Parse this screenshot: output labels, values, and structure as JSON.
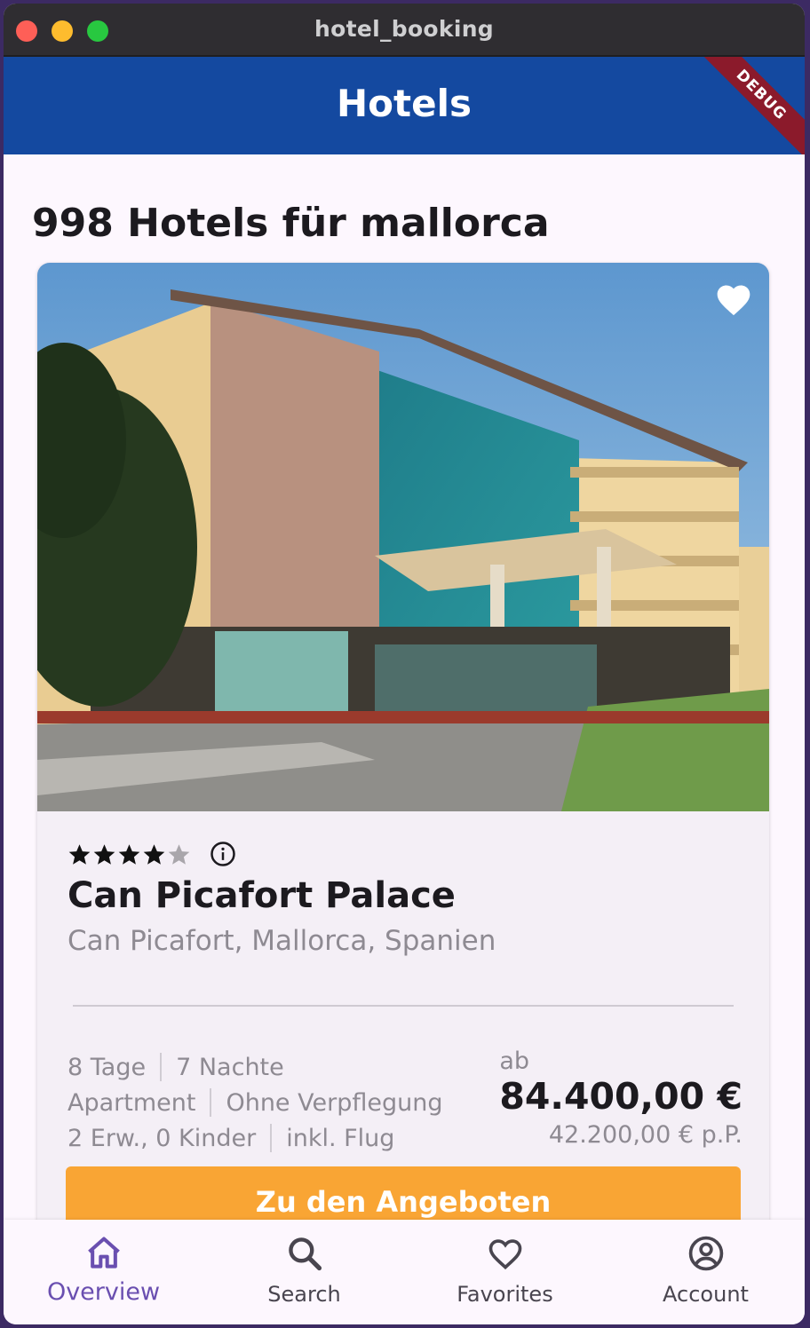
{
  "window": {
    "title": "hotel_booking"
  },
  "appbar": {
    "title": "Hotels",
    "debug_banner": "DEBUG"
  },
  "results": {
    "heading": "998 Hotels für mallorca"
  },
  "hotel": {
    "stars": 4,
    "max_stars": 5,
    "name": "Can Picafort Palace",
    "location": "Can Picafort, Mallorca, Spanien",
    "duration_days": "8 Tage",
    "duration_nights": "7 Nachte",
    "room_type": "Apartment",
    "board": "Ohne Verpflegung",
    "travellers": "2 Erw., 0 Kinder",
    "transport": "inkl. Flug",
    "price_prefix": "ab",
    "price_total": "84.400,00 €",
    "price_per_person": "42.200,00 € p.P.",
    "favorite": true,
    "cta_label": "Zu den Angeboten"
  },
  "nav": {
    "items": [
      {
        "label": "Overview",
        "icon": "home-icon",
        "active": true
      },
      {
        "label": "Search",
        "icon": "search-icon",
        "active": false
      },
      {
        "label": "Favorites",
        "icon": "heart-icon",
        "active": false
      },
      {
        "label": "Account",
        "icon": "account-icon",
        "active": false
      }
    ]
  },
  "colors": {
    "appbar": "#1449a0",
    "cta": "#f9a534",
    "nav_active": "#6a4fb0",
    "debug_banner": "#8b1a2b"
  }
}
